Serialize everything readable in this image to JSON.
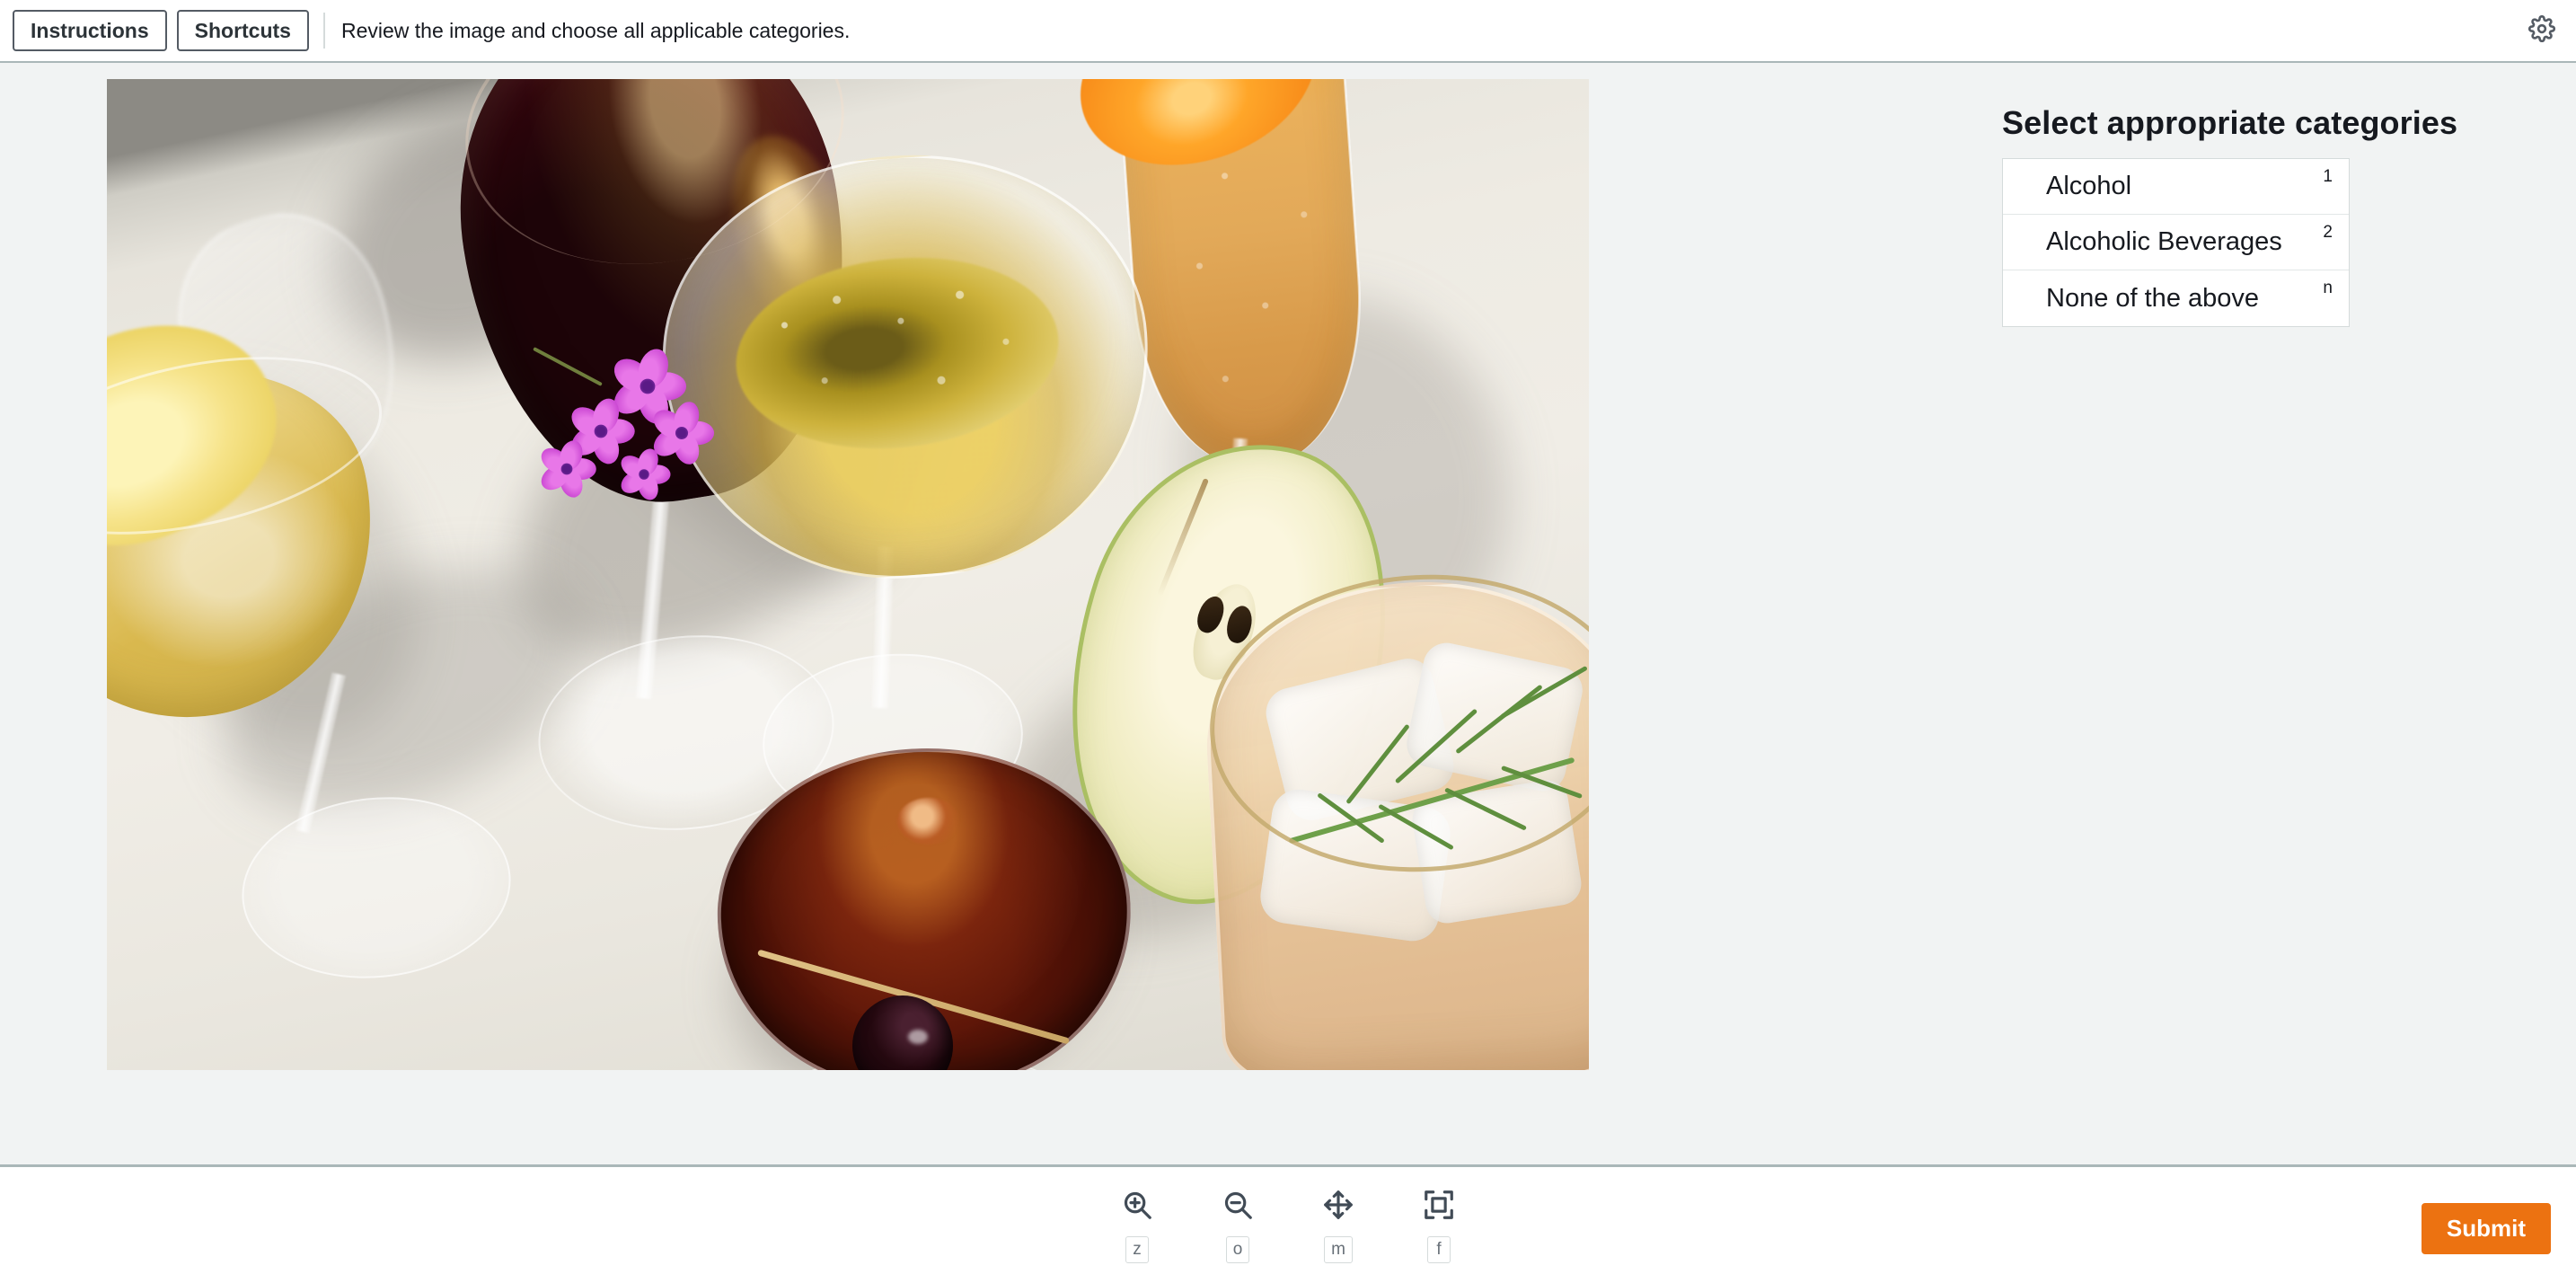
{
  "header": {
    "instructions_button": "Instructions",
    "shortcuts_button": "Shortcuts",
    "task_instruction": "Review the image and choose all applicable categories.",
    "settings_icon": "gear-icon"
  },
  "main": {
    "image_alt": "Overhead photo of assorted alcoholic cocktails on a white tablecloth: red wine glass, lemon-garnished white wine glass, champagne coupe with purple flowers, champagne flute with orange slice, pear-garnished iced cocktail with dill, and a dark Manhattan with a cherry."
  },
  "side_panel": {
    "title": "Select appropriate categories",
    "options": [
      {
        "label": "Alcohol",
        "key": "1",
        "selected": false
      },
      {
        "label": "Alcoholic Beverages",
        "key": "2",
        "selected": false
      },
      {
        "label": "None of the above",
        "key": "n",
        "selected": false
      }
    ]
  },
  "footer": {
    "tools": [
      {
        "name": "zoom-in-icon",
        "key": "z"
      },
      {
        "name": "zoom-out-icon",
        "key": "o"
      },
      {
        "name": "move-icon",
        "key": "m"
      },
      {
        "name": "fit-to-screen-icon",
        "key": "f"
      }
    ],
    "submit_label": "Submit"
  },
  "colors": {
    "accent": "#ec7211",
    "page_background": "#f1f3f3",
    "border": "#aab7b8",
    "text": "#16191f"
  }
}
